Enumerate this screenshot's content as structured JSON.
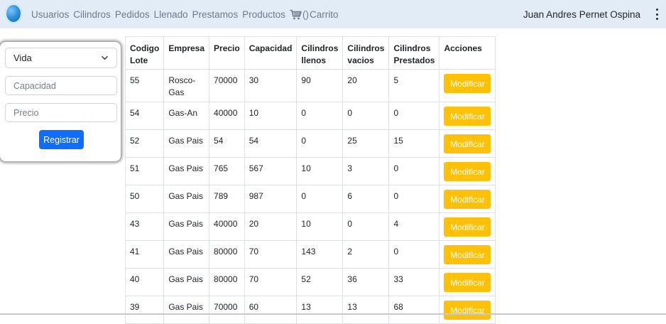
{
  "navbar": {
    "links": [
      "Usuarios",
      "Cilindros",
      "Pedidos",
      "Llenado",
      "Prestamos",
      "Productos"
    ],
    "cart_count": "()",
    "cart_label": "Carrito",
    "user_name": "Juan Andres Pernet Ospina"
  },
  "form": {
    "select_value": "Vida",
    "capacidad_placeholder": "Capacidad",
    "precio_placeholder": "Precio",
    "submit_label": "Registrar"
  },
  "table": {
    "headers": {
      "lote": "Codigo Lote",
      "empresa": "Empresa",
      "precio": "Precio",
      "capacidad": "Capacidad",
      "llenos": "Cilindros llenos",
      "vacios": "Cilindros vacios",
      "prestados": "Cilindros Prestados",
      "acciones": "Acciones"
    },
    "action_label": "Modificar",
    "rows": [
      {
        "lote": "55",
        "empresa": "Rosco-Gas",
        "precio": "70000",
        "capacidad": "30",
        "llenos": "90",
        "vacios": "20",
        "prestados": "5"
      },
      {
        "lote": "54",
        "empresa": "Gas-An",
        "precio": "40000",
        "capacidad": "10",
        "llenos": "0",
        "vacios": "0",
        "prestados": "0"
      },
      {
        "lote": "52",
        "empresa": "Gas Pais",
        "precio": "54",
        "capacidad": "54",
        "llenos": "0",
        "vacios": "25",
        "prestados": "15"
      },
      {
        "lote": "51",
        "empresa": "Gas Pais",
        "precio": "765",
        "capacidad": "567",
        "llenos": "10",
        "vacios": "3",
        "prestados": "0"
      },
      {
        "lote": "50",
        "empresa": "Gas Pais",
        "precio": "789",
        "capacidad": "987",
        "llenos": "0",
        "vacios": "6",
        "prestados": "0"
      },
      {
        "lote": "43",
        "empresa": "Gas Pais",
        "precio": "40000",
        "capacidad": "20",
        "llenos": "10",
        "vacios": "0",
        "prestados": "4"
      },
      {
        "lote": "41",
        "empresa": "Gas Pais",
        "precio": "80000",
        "capacidad": "70",
        "llenos": "143",
        "vacios": "2",
        "prestados": "0"
      },
      {
        "lote": "40",
        "empresa": "Gas Pais",
        "precio": "80000",
        "capacidad": "70",
        "llenos": "52",
        "vacios": "36",
        "prestados": "33"
      },
      {
        "lote": "39",
        "empresa": "Gas Pais",
        "precio": "70000",
        "capacidad": "60",
        "llenos": "13",
        "vacios": "13",
        "prestados": "68"
      }
    ]
  },
  "colors": {
    "navbar_bg": "#e2ecf7",
    "primary": "#0d6efd",
    "warning": "#ffc107"
  }
}
